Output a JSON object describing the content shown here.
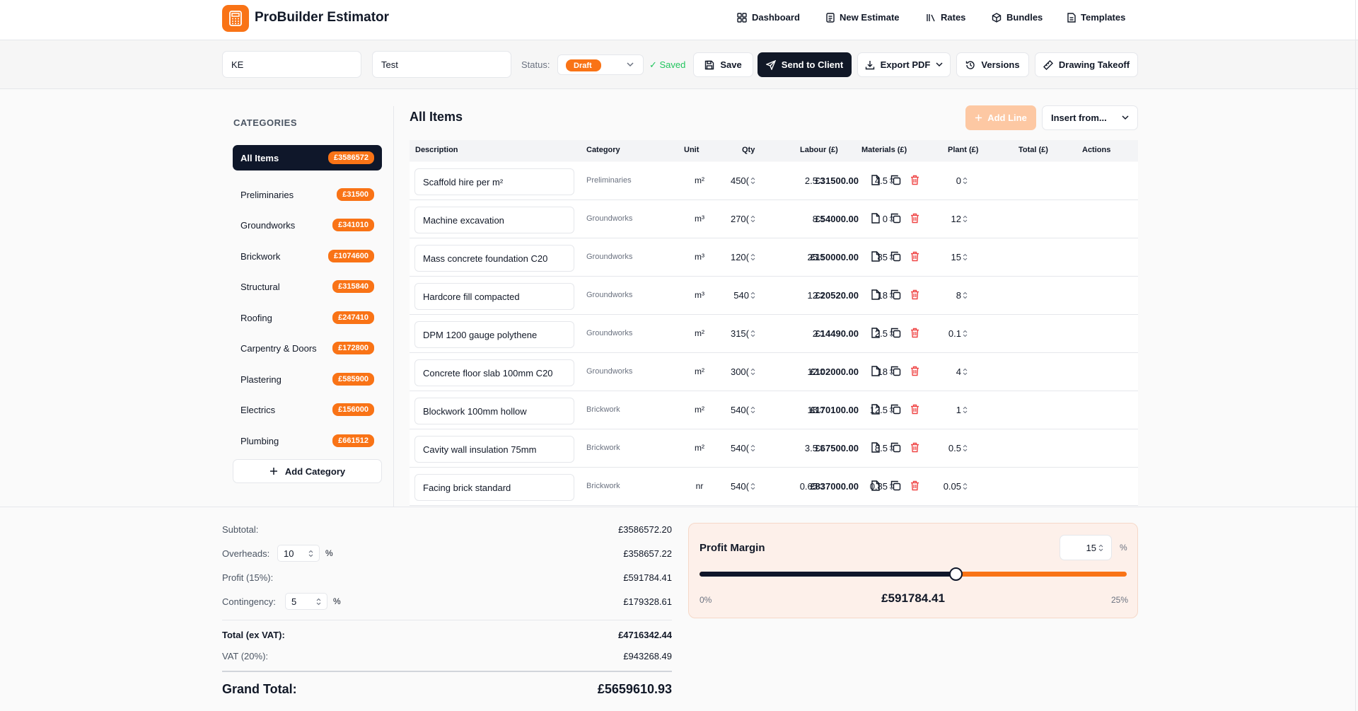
{
  "app": {
    "name": "ProBuilder Estimator"
  },
  "nav": [
    {
      "label": "Dashboard",
      "icon": "dashboard-icon"
    },
    {
      "label": "New Estimate",
      "icon": "document-icon"
    },
    {
      "label": "Rates",
      "icon": "rates-icon"
    },
    {
      "label": "Bundles",
      "icon": "cube-icon"
    },
    {
      "label": "Templates",
      "icon": "template-icon"
    }
  ],
  "toolbar": {
    "client_value": "KE",
    "project_value": "Test",
    "status_label": "Status:",
    "status_value": "Draft",
    "saved_label": "✓ Saved",
    "save_label": "Save",
    "send_label": "Send to Client",
    "export_label": "Export PDF",
    "versions_label": "Versions",
    "takeoff_label": "Drawing Takeoff"
  },
  "sidebar": {
    "title": "CATEGORIES",
    "items": [
      {
        "label": "All Items",
        "badge": "£3586572",
        "active": true
      },
      {
        "label": "Preliminaries",
        "badge": "£31500"
      },
      {
        "label": "Groundworks",
        "badge": "£341010"
      },
      {
        "label": "Brickwork",
        "badge": "£1074600"
      },
      {
        "label": "Structural",
        "badge": "£315840"
      },
      {
        "label": "Roofing",
        "badge": "£247410"
      },
      {
        "label": "Carpentry & Doors",
        "badge": "£172800"
      },
      {
        "label": "Plastering",
        "badge": "£585900"
      },
      {
        "label": "Electrics",
        "badge": "£156000"
      },
      {
        "label": "Plumbing",
        "badge": "£661512"
      }
    ],
    "add_label": "Add Category"
  },
  "table": {
    "title": "All Items",
    "add_line_label": "Add Line",
    "insert_from_label": "Insert from...",
    "columns": [
      "Description",
      "Category",
      "Unit",
      "Qty",
      "Labour (£)",
      "Materials (£)",
      "Plant (£)",
      "Total (£)",
      "Actions"
    ],
    "rows": [
      {
        "description": "Scaffold hire per m²",
        "category": "Preliminaries",
        "unit": "m²",
        "qty": "450(",
        "labour": "2.5",
        "materials": "4.5",
        "plant": "0",
        "total": "£31500.00"
      },
      {
        "description": "Machine excavation",
        "category": "Groundworks",
        "unit": "m³",
        "qty": "270(",
        "labour": "8",
        "materials": "0",
        "plant": "12",
        "total": "£54000.00"
      },
      {
        "description": "Mass concrete foundation C20",
        "category": "Groundworks",
        "unit": "m³",
        "qty": "120(",
        "labour": "25",
        "materials": "85",
        "plant": "15",
        "total": "£150000.00"
      },
      {
        "description": "Hardcore fill compacted",
        "category": "Groundworks",
        "unit": "m³",
        "qty": "540",
        "labour": "12",
        "materials": "18",
        "plant": "8",
        "total": "£20520.00"
      },
      {
        "description": "DPM 1200 gauge polythene",
        "category": "Groundworks",
        "unit": "m²",
        "qty": "315(",
        "labour": "2",
        "materials": "2.5",
        "plant": "0.1",
        "total": "£14490.00"
      },
      {
        "description": "Concrete floor slab 100mm C20",
        "category": "Groundworks",
        "unit": "m²",
        "qty": "300(",
        "labour": "12",
        "materials": "18",
        "plant": "4",
        "total": "£102000.00"
      },
      {
        "description": "Blockwork 100mm hollow",
        "category": "Brickwork",
        "unit": "m²",
        "qty": "540(",
        "labour": "18",
        "materials": "12.5",
        "plant": "1",
        "total": "£170100.00"
      },
      {
        "description": "Cavity wall insulation 75mm",
        "category": "Brickwork",
        "unit": "m²",
        "qty": "540(",
        "labour": "3.5",
        "materials": "8.5",
        "plant": "0.5",
        "total": "£67500.00"
      },
      {
        "description": "Facing brick standard",
        "category": "Brickwork",
        "unit": "nr",
        "qty": "540(",
        "labour": "0.65",
        "materials": "0.85",
        "plant": "0.05",
        "total": "£837000.00"
      }
    ]
  },
  "summary": {
    "subtotal_label": "Subtotal:",
    "subtotal": "£3586572.20",
    "overheads_label": "Overheads:",
    "overheads_pct": "10",
    "overheads": "£358657.22",
    "profit_label": "Profit (15%):",
    "profit": "£591784.41",
    "contingency_label": "Contingency:",
    "contingency_pct": "5",
    "contingency": "£179328.61",
    "pct_sign": "%",
    "total_ex_vat_label": "Total (ex VAT):",
    "total_ex_vat": "£4716342.44",
    "vat_label": "VAT (20%):",
    "vat": "£943268.49",
    "grand_total_label": "Grand Total:",
    "grand_total": "£5659610.93"
  },
  "profit_margin": {
    "title": "Profit Margin",
    "value": "15",
    "pct_sign": "%",
    "min_label": "0%",
    "max_label": "25%",
    "amount": "£591784.41",
    "fraction": 0.6
  },
  "colors": {
    "accent": "#f97316",
    "dark": "#0f172a",
    "delete": "#ef4444",
    "saved": "#22c55e"
  }
}
